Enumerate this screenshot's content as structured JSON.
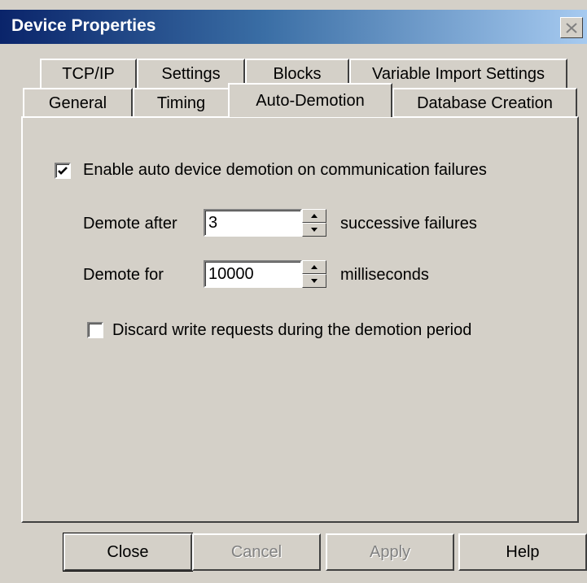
{
  "window": {
    "title": "Device Properties"
  },
  "tabs": {
    "row_back": [
      "TCP/IP",
      "Settings",
      "Blocks",
      "Variable Import Settings"
    ],
    "row_front": [
      "General",
      "Timing",
      "Auto-Demotion",
      "Database Creation"
    ],
    "active": "Auto-Demotion"
  },
  "auto_demotion": {
    "enable_label": "Enable auto device demotion on communication failures",
    "enable_checked": true,
    "demote_after_label": "Demote after",
    "demote_after_value": "3",
    "demote_after_unit": "successive failures",
    "demote_for_label": "Demote for",
    "demote_for_value": "10000",
    "demote_for_unit": "milliseconds",
    "discard_label": "Discard write requests during the demotion period",
    "discard_checked": false
  },
  "buttons": {
    "close": "Close",
    "cancel": "Cancel",
    "apply": "Apply",
    "help": "Help"
  },
  "icons": {
    "close": "close-icon",
    "check": "checkmark-icon",
    "spin_up": "spin-up-icon",
    "spin_down": "spin-down-icon"
  }
}
